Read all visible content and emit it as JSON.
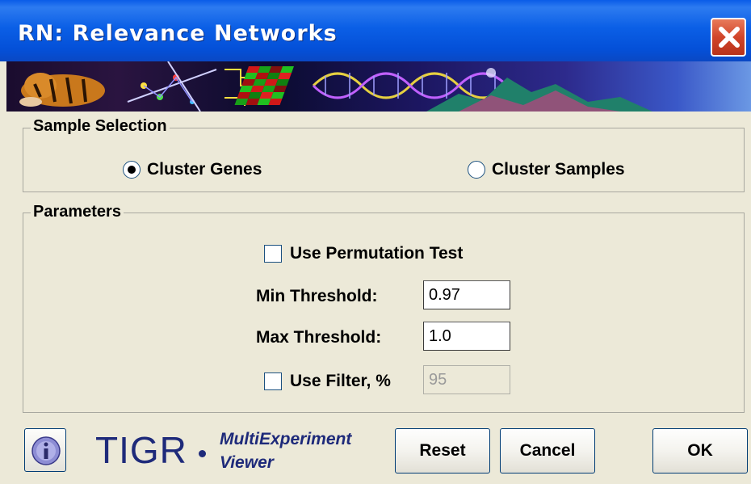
{
  "window": {
    "title": "RN: Relevance Networks"
  },
  "sample_selection": {
    "title": "Sample Selection",
    "options": [
      {
        "label": "Cluster Genes",
        "selected": true
      },
      {
        "label": "Cluster Samples",
        "selected": false
      }
    ]
  },
  "parameters": {
    "title": "Parameters",
    "use_permutation_test": {
      "label": "Use Permutation Test",
      "checked": false
    },
    "min_threshold": {
      "label": "Min Threshold:",
      "value": "0.97"
    },
    "max_threshold": {
      "label": "Max Threshold:",
      "value": "1.0"
    },
    "use_filter": {
      "label": "Use Filter, %",
      "checked": false,
      "value": "95"
    }
  },
  "footer": {
    "logo_text": "TIGR",
    "product_line1": "MultiExperiment",
    "product_line2": "Viewer",
    "buttons": {
      "reset": "Reset",
      "cancel": "Cancel",
      "ok": "OK"
    }
  },
  "icons": [
    "close-icon",
    "info-icon",
    "banner-image"
  ],
  "colors": {
    "titlebar": "#0b5fe6",
    "close": "#d1452a",
    "logo": "#1e2a7a",
    "background": "#ece9d8"
  }
}
